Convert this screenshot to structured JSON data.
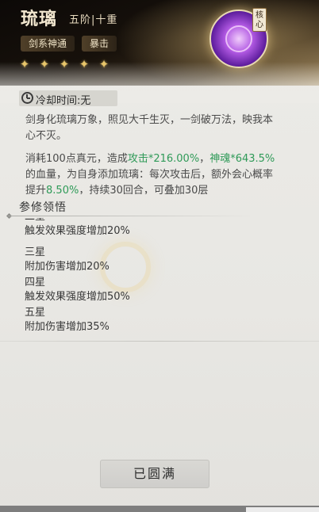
{
  "header": {
    "skill_name": "琉璃",
    "level": "五阶|十重",
    "tags": [
      "剑系神通",
      "暴击"
    ],
    "star_count": 5,
    "star_icon": "flame-star-icon",
    "core_badge": "核心",
    "accent_gold": "#e7c56a",
    "emblem_color": "#8a3cc8"
  },
  "cooldown": {
    "icon": "clock-icon",
    "text": "冷却时间:无"
  },
  "description": "剑身化琉璃万象，照见大千生灭，一剑破万法，映我本心不灭。",
  "effect": {
    "part1": "消耗100点真元，造成",
    "hl1": "攻击*216.00%",
    "part2": "，",
    "hl2": "神魂*643.5%",
    "part3": "的血量，为自身添加琉璃：每次攻击后，额外会心概率提升",
    "hl3": "8.50%",
    "part4": "，持续30回合，可叠加30层",
    "highlight_color": "#2f9a58"
  },
  "section": {
    "title": "参修领悟"
  },
  "stages": [
    {
      "title": "二星",
      "value": "触发效果强度增加20%"
    },
    {
      "title": "三星",
      "value": "附加伤害增加20%"
    },
    {
      "title": "四星",
      "value": "触发效果强度增加50%"
    },
    {
      "title": "五星",
      "value": "附加伤害增加35%"
    }
  ],
  "footer": {
    "button_label": "已圆满"
  }
}
